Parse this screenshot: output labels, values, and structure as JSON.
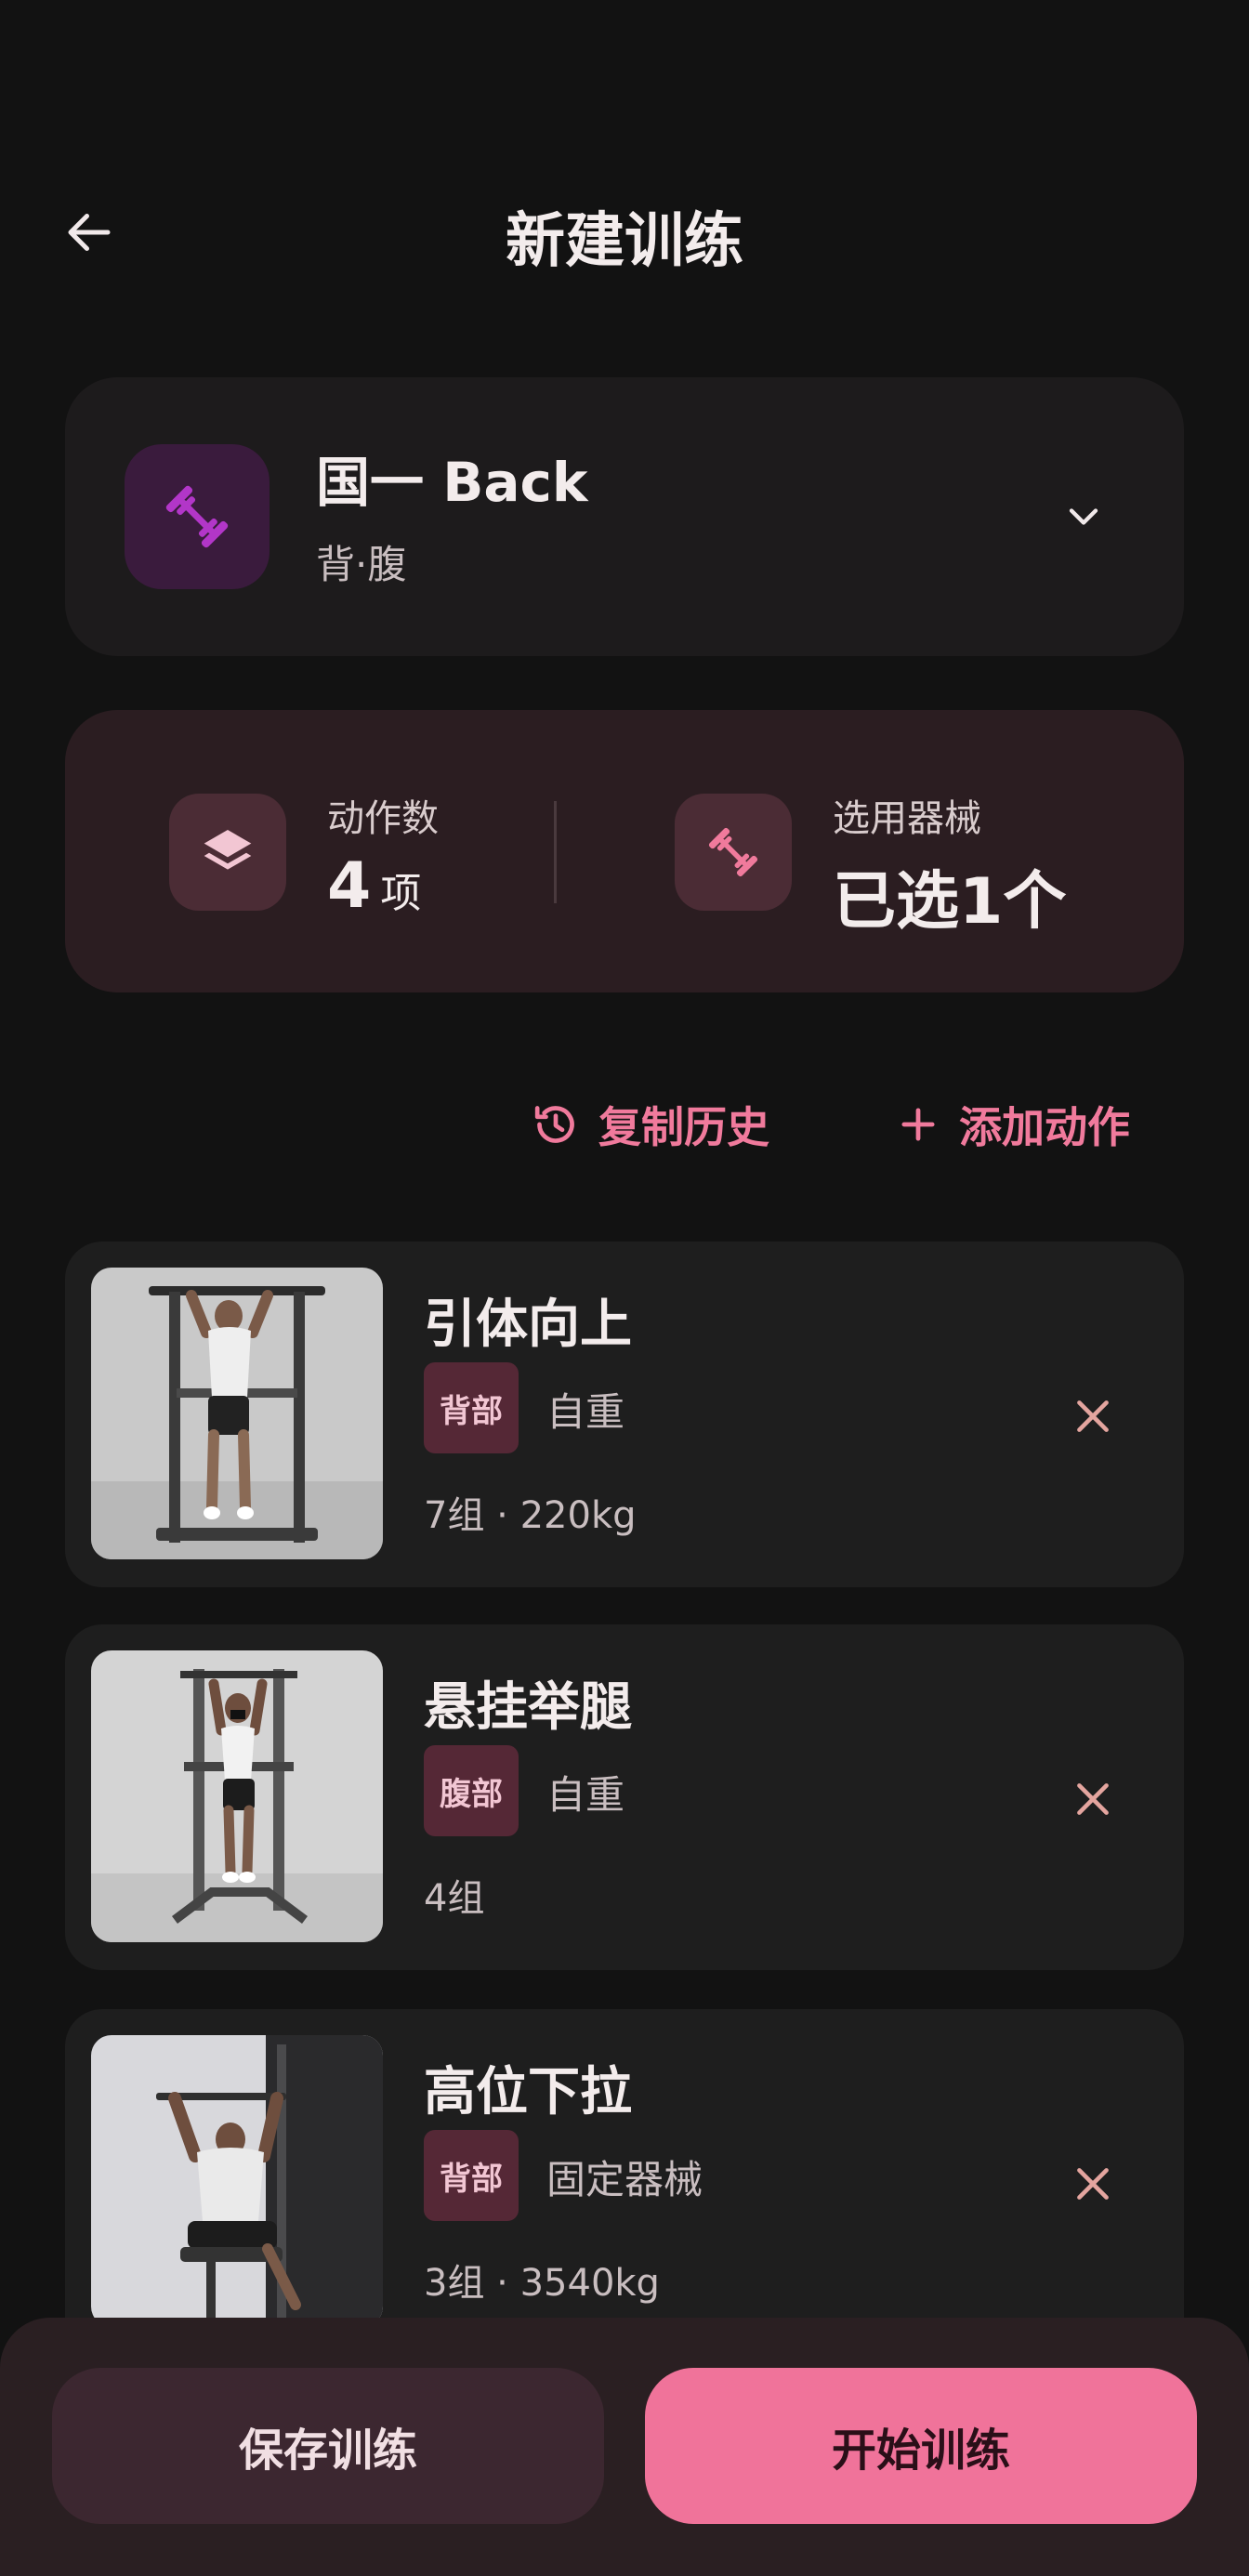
{
  "header": {
    "title": "新建训练"
  },
  "plan": {
    "name": "国一 Back",
    "subtitle": "背·腹"
  },
  "stats": {
    "exercise_count_label": "动作数",
    "exercise_count_value": "4",
    "exercise_count_unit": "项",
    "equipment_label": "选用器械",
    "equipment_value": "已选1个"
  },
  "actions": {
    "copy_history": "复制历史",
    "add_exercise": "添加动作"
  },
  "exercises": [
    {
      "name": "引体向上",
      "tag": "背部",
      "equipment": "自重",
      "meta": "7组 · 220kg"
    },
    {
      "name": "悬挂举腿",
      "tag": "腹部",
      "equipment": "自重",
      "meta": "4组"
    },
    {
      "name": "高位下拉",
      "tag": "背部",
      "equipment": "固定器械",
      "meta": "3组 · 3540kg"
    }
  ],
  "footer": {
    "save_label": "保存训练",
    "start_label": "开始训练"
  },
  "colors": {
    "accent": "#f0739a",
    "background": "#121212",
    "card": "#1e1e1e",
    "tag_bg": "#552836"
  },
  "icons": [
    "back-arrow-icon",
    "dumbbell-icon",
    "chevron-down-icon",
    "layers-icon",
    "history-icon",
    "plus-icon",
    "close-icon"
  ]
}
